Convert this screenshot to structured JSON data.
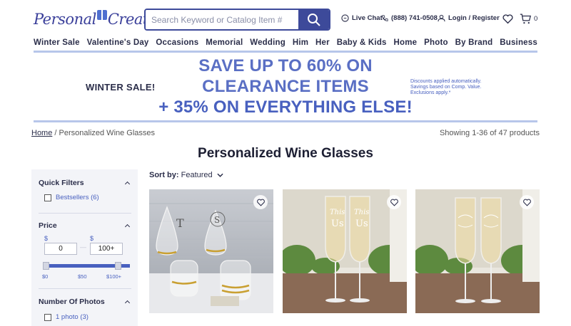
{
  "header": {
    "logo_text_1": "Personal",
    "logo_text_2": "Creations",
    "search_placeholder": "Search Keyword or Catalog Item #",
    "live_chat": "Live Chat",
    "phone": "(888) 741-0508",
    "login": "Login / Register",
    "cart_count": "0"
  },
  "nav": [
    "Winter Sale",
    "Valentine's Day",
    "Occasions",
    "Memorial",
    "Wedding",
    "Him",
    "Her",
    "Baby & Kids",
    "Home",
    "Photo",
    "By Brand",
    "Business"
  ],
  "promo": {
    "left": "WINTER SALE!",
    "line1": "SAVE UP TO 60% ON",
    "line2": "CLEARANCE ITEMS",
    "line3": "+ 35% ON EVERYTHING ELSE!",
    "note_1": "Discounts applied automatically.",
    "note_2": "Savings based on Comp. Value.",
    "note_3": "Exclusions apply.*"
  },
  "breadcrumb": {
    "home": "Home",
    "separator": "/",
    "current": "Personalized Wine Glasses"
  },
  "showing": "Showing 1-36 of 47 products",
  "page_title": "Personalized Wine Glasses",
  "filters": {
    "quick_filters": "Quick Filters",
    "bestsellers_label": "Bestsellers",
    "bestsellers_count": "(6)",
    "price": "Price",
    "price_currency": "$",
    "price_min": "0",
    "price_max": "100+",
    "price_dash": "—",
    "price_range_min": 0,
    "price_range_max": 1,
    "tick_0": "$0",
    "tick_50": "$50",
    "tick_100": "$100+",
    "photos": "Number Of Photos",
    "one_photo_label": "1 photo",
    "one_photo_count": "(3)"
  },
  "sort": {
    "label": "Sort by:",
    "value": "Featured"
  },
  "products": [
    {
      "name": "product-card-wine-glasses"
    },
    {
      "name": "product-card-champagne-flutes"
    },
    {
      "name": "product-card-champagne-flutes-script"
    }
  ],
  "colors": {
    "brand": "#3d4a9a",
    "promo": "#5a6fc4",
    "link": "#4860bf"
  }
}
